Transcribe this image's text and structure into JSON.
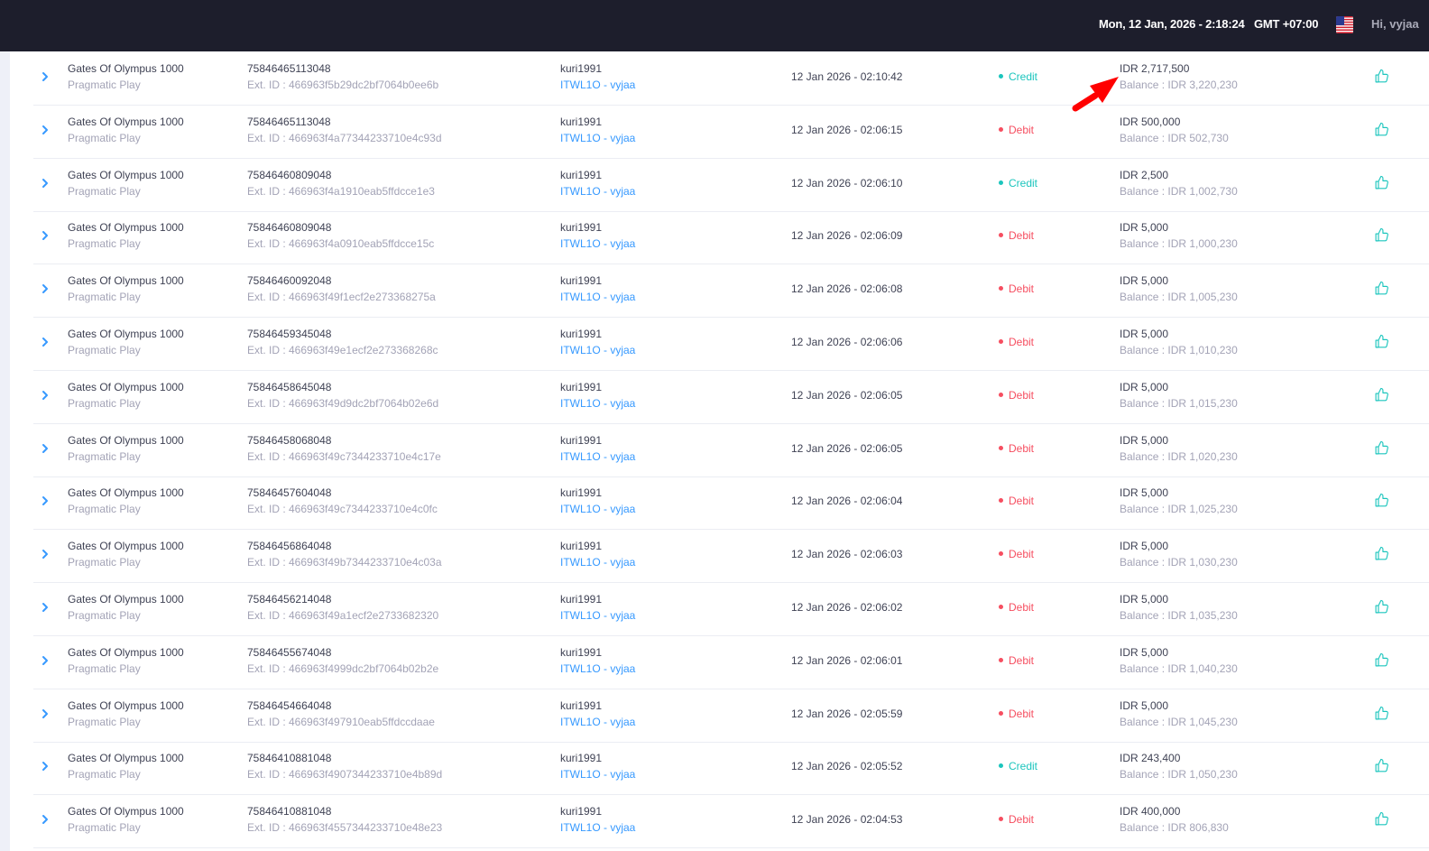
{
  "header": {
    "datetime": "Mon, 12 Jan, 2026 - 2:18:24",
    "timezone": "GMT +07:00",
    "greeting": "Hi, vyjaa"
  },
  "colors": {
    "credit": "#1bc5bd",
    "debit": "#f64e60",
    "link": "#3699ff",
    "topbar": "#1d1e2c",
    "annotation_arrow": "#ff0000"
  },
  "icons": {
    "expand": "chevron-right-icon",
    "action": "thumbs-up-icon",
    "flag": "us-flag-icon"
  },
  "transactions": [
    {
      "game": "Gates Of Olympus 1000",
      "provider": "Pragmatic Play",
      "round_id": "75846465113048",
      "ext_id": "Ext. ID : 466963f5b29dc2bf7064b0ee6b",
      "user": "kuri1991",
      "agent": "ITWL1O - vyjaa",
      "time": "12 Jan 2026 - 02:10:42",
      "type": "Credit",
      "amount": "IDR 2,717,500",
      "balance": "Balance : IDR 3,220,230"
    },
    {
      "game": "Gates Of Olympus 1000",
      "provider": "Pragmatic Play",
      "round_id": "75846465113048",
      "ext_id": "Ext. ID : 466963f4a77344233710e4c93d",
      "user": "kuri1991",
      "agent": "ITWL1O - vyjaa",
      "time": "12 Jan 2026 - 02:06:15",
      "type": "Debit",
      "amount": "IDR 500,000",
      "balance": "Balance : IDR 502,730"
    },
    {
      "game": "Gates Of Olympus 1000",
      "provider": "Pragmatic Play",
      "round_id": "75846460809048",
      "ext_id": "Ext. ID : 466963f4a1910eab5ffdcce1e3",
      "user": "kuri1991",
      "agent": "ITWL1O - vyjaa",
      "time": "12 Jan 2026 - 02:06:10",
      "type": "Credit",
      "amount": "IDR 2,500",
      "balance": "Balance : IDR 1,002,730"
    },
    {
      "game": "Gates Of Olympus 1000",
      "provider": "Pragmatic Play",
      "round_id": "75846460809048",
      "ext_id": "Ext. ID : 466963f4a0910eab5ffdcce15c",
      "user": "kuri1991",
      "agent": "ITWL1O - vyjaa",
      "time": "12 Jan 2026 - 02:06:09",
      "type": "Debit",
      "amount": "IDR 5,000",
      "balance": "Balance : IDR 1,000,230"
    },
    {
      "game": "Gates Of Olympus 1000",
      "provider": "Pragmatic Play",
      "round_id": "75846460092048",
      "ext_id": "Ext. ID : 466963f49f1ecf2e273368275a",
      "user": "kuri1991",
      "agent": "ITWL1O - vyjaa",
      "time": "12 Jan 2026 - 02:06:08",
      "type": "Debit",
      "amount": "IDR 5,000",
      "balance": "Balance : IDR 1,005,230"
    },
    {
      "game": "Gates Of Olympus 1000",
      "provider": "Pragmatic Play",
      "round_id": "75846459345048",
      "ext_id": "Ext. ID : 466963f49e1ecf2e273368268c",
      "user": "kuri1991",
      "agent": "ITWL1O - vyjaa",
      "time": "12 Jan 2026 - 02:06:06",
      "type": "Debit",
      "amount": "IDR 5,000",
      "balance": "Balance : IDR 1,010,230"
    },
    {
      "game": "Gates Of Olympus 1000",
      "provider": "Pragmatic Play",
      "round_id": "75846458645048",
      "ext_id": "Ext. ID : 466963f49d9dc2bf7064b02e6d",
      "user": "kuri1991",
      "agent": "ITWL1O - vyjaa",
      "time": "12 Jan 2026 - 02:06:05",
      "type": "Debit",
      "amount": "IDR 5,000",
      "balance": "Balance : IDR 1,015,230"
    },
    {
      "game": "Gates Of Olympus 1000",
      "provider": "Pragmatic Play",
      "round_id": "75846458068048",
      "ext_id": "Ext. ID : 466963f49c7344233710e4c17e",
      "user": "kuri1991",
      "agent": "ITWL1O - vyjaa",
      "time": "12 Jan 2026 - 02:06:05",
      "type": "Debit",
      "amount": "IDR 5,000",
      "balance": "Balance : IDR 1,020,230"
    },
    {
      "game": "Gates Of Olympus 1000",
      "provider": "Pragmatic Play",
      "round_id": "75846457604048",
      "ext_id": "Ext. ID : 466963f49c7344233710e4c0fc",
      "user": "kuri1991",
      "agent": "ITWL1O - vyjaa",
      "time": "12 Jan 2026 - 02:06:04",
      "type": "Debit",
      "amount": "IDR 5,000",
      "balance": "Balance : IDR 1,025,230"
    },
    {
      "game": "Gates Of Olympus 1000",
      "provider": "Pragmatic Play",
      "round_id": "75846456864048",
      "ext_id": "Ext. ID : 466963f49b7344233710e4c03a",
      "user": "kuri1991",
      "agent": "ITWL1O - vyjaa",
      "time": "12 Jan 2026 - 02:06:03",
      "type": "Debit",
      "amount": "IDR 5,000",
      "balance": "Balance : IDR 1,030,230"
    },
    {
      "game": "Gates Of Olympus 1000",
      "provider": "Pragmatic Play",
      "round_id": "75846456214048",
      "ext_id": "Ext. ID : 466963f49a1ecf2e2733682320",
      "user": "kuri1991",
      "agent": "ITWL1O - vyjaa",
      "time": "12 Jan 2026 - 02:06:02",
      "type": "Debit",
      "amount": "IDR 5,000",
      "balance": "Balance : IDR 1,035,230"
    },
    {
      "game": "Gates Of Olympus 1000",
      "provider": "Pragmatic Play",
      "round_id": "75846455674048",
      "ext_id": "Ext. ID : 466963f4999dc2bf7064b02b2e",
      "user": "kuri1991",
      "agent": "ITWL1O - vyjaa",
      "time": "12 Jan 2026 - 02:06:01",
      "type": "Debit",
      "amount": "IDR 5,000",
      "balance": "Balance : IDR 1,040,230"
    },
    {
      "game": "Gates Of Olympus 1000",
      "provider": "Pragmatic Play",
      "round_id": "75846454664048",
      "ext_id": "Ext. ID : 466963f497910eab5ffdccdaae",
      "user": "kuri1991",
      "agent": "ITWL1O - vyjaa",
      "time": "12 Jan 2026 - 02:05:59",
      "type": "Debit",
      "amount": "IDR 5,000",
      "balance": "Balance : IDR 1,045,230"
    },
    {
      "game": "Gates Of Olympus 1000",
      "provider": "Pragmatic Play",
      "round_id": "75846410881048",
      "ext_id": "Ext. ID : 466963f4907344233710e4b89d",
      "user": "kuri1991",
      "agent": "ITWL1O - vyjaa",
      "time": "12 Jan 2026 - 02:05:52",
      "type": "Credit",
      "amount": "IDR 243,400",
      "balance": "Balance : IDR 1,050,230"
    },
    {
      "game": "Gates Of Olympus 1000",
      "provider": "Pragmatic Play",
      "round_id": "75846410881048",
      "ext_id": "Ext. ID : 466963f4557344233710e48e23",
      "user": "kuri1991",
      "agent": "ITWL1O - vyjaa",
      "time": "12 Jan 2026 - 02:04:53",
      "type": "Debit",
      "amount": "IDR 400,000",
      "balance": "Balance : IDR 806,830"
    }
  ]
}
